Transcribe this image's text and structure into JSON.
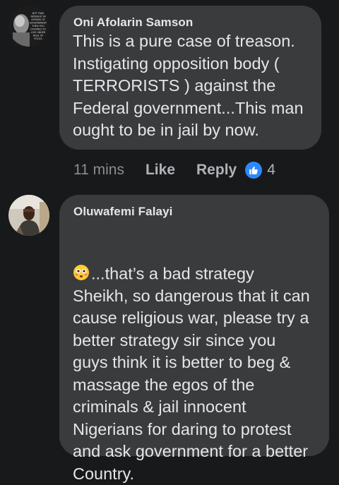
{
  "comments": [
    {
      "author": "Oni Afolarin Samson",
      "text": "This is a pure case of treason.\nInstigating opposition body (\nTERRORISTS ) against the\nFederal government...This man\nought to be in jail by now.",
      "time": "11 mins",
      "like_label": "Like",
      "reply_label": "Reply",
      "reaction_count": "4",
      "avatar_icon": "quote-portrait-avatar-icon",
      "avatar_text": "NOT TAKE AN INTEREST IN THE AFFAIRS OF YOUR GOVERNMENT THEN YOU ARE DOOMED TO LIVE UNDER THE RULE OF FOOLS"
    },
    {
      "author": "Oluwafemi Falayi",
      "emoji": "flushed-face-emoji",
      "text": "...that’s a bad strategy\nSheikh, so dangerous that it can\ncause religious war, please try a\nbetter strategy sir since you\nguys think it is better to beg &\nmassage the egos of the\ncriminals & jail innocent\nNigerians for daring to protest\nand ask government for a better\nCountry.",
      "avatar_icon": "person-photo-avatar-icon"
    }
  ],
  "colors": {
    "background": "#18191a",
    "bubble": "#3a3b3c",
    "text": "#e4e6eb",
    "meta": "#8a8d91",
    "like_reaction": "#2d88ff"
  }
}
